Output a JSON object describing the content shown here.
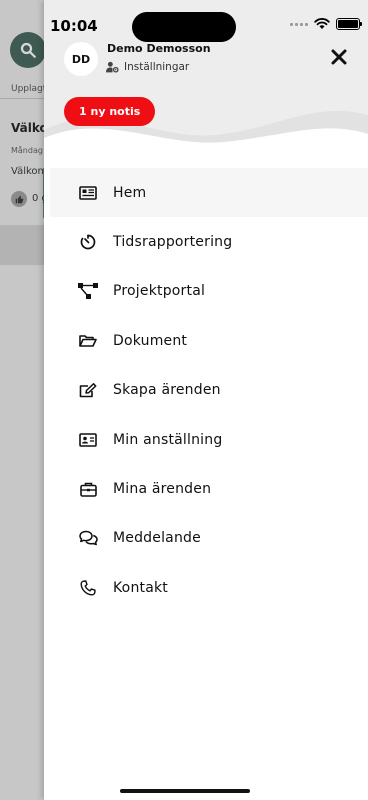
{
  "status_bar": {
    "time": "10:04"
  },
  "background": {
    "upplagt": "Upplagt",
    "card_title": "Välko",
    "card_date": "Måndag",
    "card_text": "Välkom",
    "like_count": "0 g"
  },
  "drawer": {
    "avatar_initials": "DD",
    "user_name": "Demo Demosson",
    "settings_label": "Inställningar",
    "notification_label": "1 ny notis",
    "accent_color": "#ee0e13",
    "menu": [
      {
        "label": "Hem",
        "icon": "newspaper-icon"
      },
      {
        "label": "Tidsrapportering",
        "icon": "timer-icon"
      },
      {
        "label": "Projektportal",
        "icon": "sitemap-icon"
      },
      {
        "label": "Dokument",
        "icon": "folder-open-icon"
      },
      {
        "label": "Skapa ärenden",
        "icon": "edit-icon"
      },
      {
        "label": "Min anställning",
        "icon": "id-card-icon"
      },
      {
        "label": "Mina ärenden",
        "icon": "briefcase-icon"
      },
      {
        "label": "Meddelande",
        "icon": "chat-icon"
      },
      {
        "label": "Kontakt",
        "icon": "phone-icon"
      }
    ]
  }
}
